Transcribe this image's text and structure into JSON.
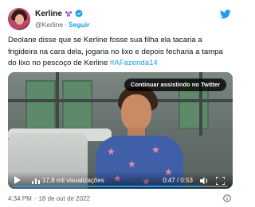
{
  "tweet": {
    "display_name": "Kerline",
    "handle": "@Kerline",
    "dot": "·",
    "follow_label": "Seguir",
    "text_main": "Deolane disse que se Kerline fosse sua filha ela tacaria a frigideira na cara dela, jogaria no lixo e depois fecharia a tampa do lixo no pescoço de Kerline ",
    "hashtag": "#AFazenda14",
    "timestamp": "4:34 PM",
    "date": "18 de out de 2022",
    "footer_separator": "·"
  },
  "video": {
    "continue_label": "Continuar assistindo no Twitter",
    "views": "17,8 mil visualizações",
    "time": "0:47 / 0:53",
    "progress": 0.887
  },
  "icons": {
    "emoji": "purple-butterfly-emoji",
    "verified": "verified-badge-icon",
    "brand": "twitter-bird-icon",
    "play": "play-icon",
    "views": "views-chart-icon",
    "volume": "volume-icon",
    "fullscreen": "fullscreen-icon",
    "info": "info-icon"
  },
  "colors": {
    "accent": "#1d9bf0",
    "text": "#0f1419",
    "muted": "#536471"
  }
}
